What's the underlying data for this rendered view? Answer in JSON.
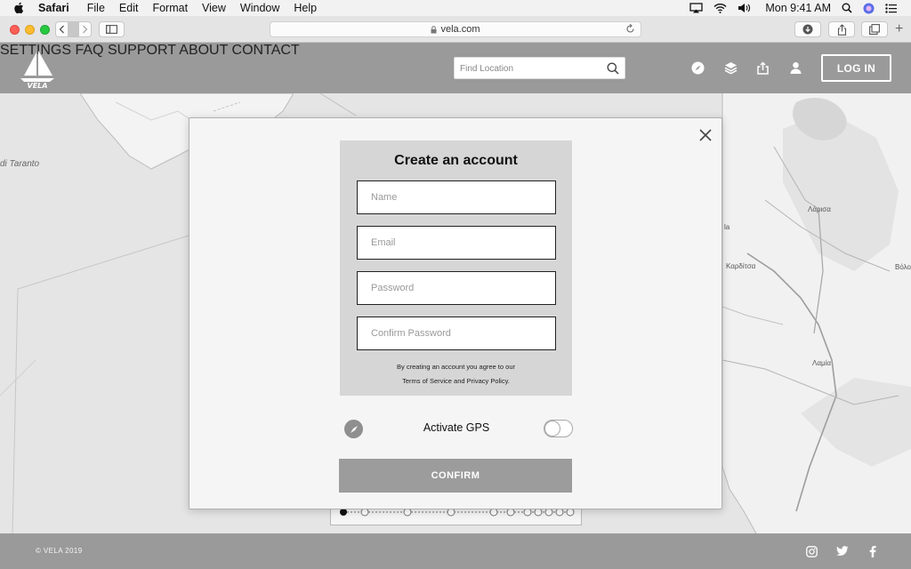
{
  "menubar": {
    "app_name": "Safari",
    "items": [
      "File",
      "Edit",
      "Format",
      "View",
      "Window",
      "Help"
    ],
    "clock": "Mon 9:41 AM"
  },
  "browser": {
    "url": "vela.com"
  },
  "header": {
    "logo_text": "VELA",
    "nav": [
      "SETTINGS",
      "FAQ",
      "SUPPORT",
      "ABOUT",
      "CONTACT"
    ],
    "search_placeholder": "Find Location",
    "login_label": "LOG IN"
  },
  "map": {
    "labels": [
      "di Taranto",
      "Λάρισα",
      "Καρδίτσα",
      "Λαμία",
      "Βόλο",
      "la"
    ]
  },
  "modal": {
    "title": "Create an account",
    "fields": [
      {
        "placeholder": "Name"
      },
      {
        "placeholder": "Email"
      },
      {
        "placeholder": "Password"
      },
      {
        "placeholder": "Confirm Password"
      }
    ],
    "terms_line1": "By creating an account you agree to our",
    "terms_line2": "Terms of Service and Privacy Policy.",
    "gps_label": "Activate GPS",
    "gps_enabled": false,
    "confirm_label": "CONFIRM"
  },
  "footer": {
    "copyright": "© VELA 2019"
  },
  "colors": {
    "header_bg": "#9a9a9a",
    "map_bg": "#e6e6e6",
    "modal_bg": "#f5f5f5",
    "form_card_bg": "#d6d6d6",
    "confirm_bg": "#9c9c9c"
  }
}
